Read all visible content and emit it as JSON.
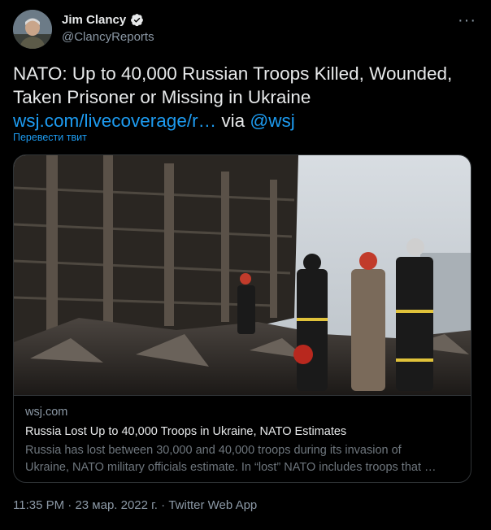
{
  "author": {
    "name": "Jim Clancy",
    "handle": "@ClancyReports",
    "avatar_icon": "avatar-photo"
  },
  "more_icon": "ellipsis-icon",
  "tweet": {
    "text": "NATO: Up to 40,000 Russian Troops Killed, Wounded, Taken Prisoner or Missing in Ukraine",
    "link_text": "wsj.com/livecoverage/r…",
    "via_text": "via",
    "mention": "@wsj",
    "translate_label": "Перевести твит"
  },
  "card": {
    "domain": "wsj.com",
    "title": "Russia Lost Up to 40,000 Troops in Ukraine, NATO Estimates",
    "description_line1": "Russia has lost between 30,000 and 40,000 troops during its invasion of",
    "description_line2": "Ukraine, NATO military officials estimate. In “lost” NATO includes troops that …"
  },
  "meta": {
    "time": "11:35 PM",
    "separator": "·",
    "date": "23 мар. 2022 г.",
    "source": "Twitter Web App"
  },
  "colors": {
    "background": "#000000",
    "text": "#e7e9ea",
    "muted": "#8b98a5",
    "link": "#1d9bf0",
    "verified": "#e7e9ea"
  }
}
